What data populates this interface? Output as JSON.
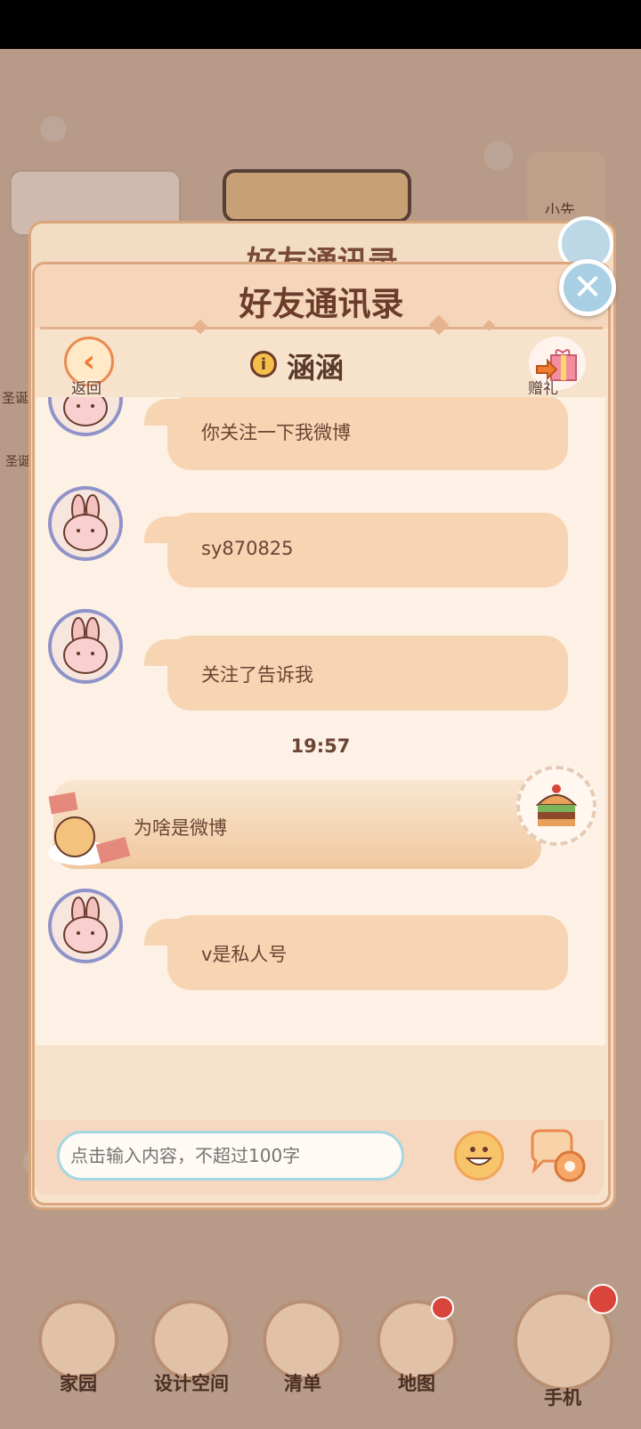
{
  "dialog": {
    "title": "好友通讯录",
    "back_title": "好友通讯录",
    "close_symbol": "✕"
  },
  "sub_header": {
    "back_label": "返回",
    "back_symbol": "‹",
    "info_symbol": "i",
    "friend_name": "涵涵",
    "gift_label": "赠礼"
  },
  "messages": [
    {
      "sender": "friend",
      "text": "你关注一下我微博"
    },
    {
      "sender": "friend",
      "text": "sy870825"
    },
    {
      "sender": "friend",
      "text": "关注了告诉我"
    },
    {
      "timestamp": "19:57"
    },
    {
      "sender": "me",
      "text": "为啥是微博"
    },
    {
      "sender": "friend",
      "text": "v是私人号"
    }
  ],
  "input": {
    "placeholder": "点击输入内容，不超过100字"
  },
  "nav": {
    "items": [
      {
        "label": "家园"
      },
      {
        "label": "设计空间"
      },
      {
        "label": "清单"
      },
      {
        "label": "地图"
      },
      {
        "label": "手机"
      }
    ]
  },
  "background": {
    "side_label_1": "圣诞",
    "side_label_2": "圣诞",
    "top_right_label": "小先"
  },
  "colors": {
    "bubble": "#f7d5b3",
    "dialog_bg": "#f7e2cc",
    "title_text": "#6b3c2c",
    "close_btn": "#a9cfe4",
    "badge": "#d9453b"
  }
}
